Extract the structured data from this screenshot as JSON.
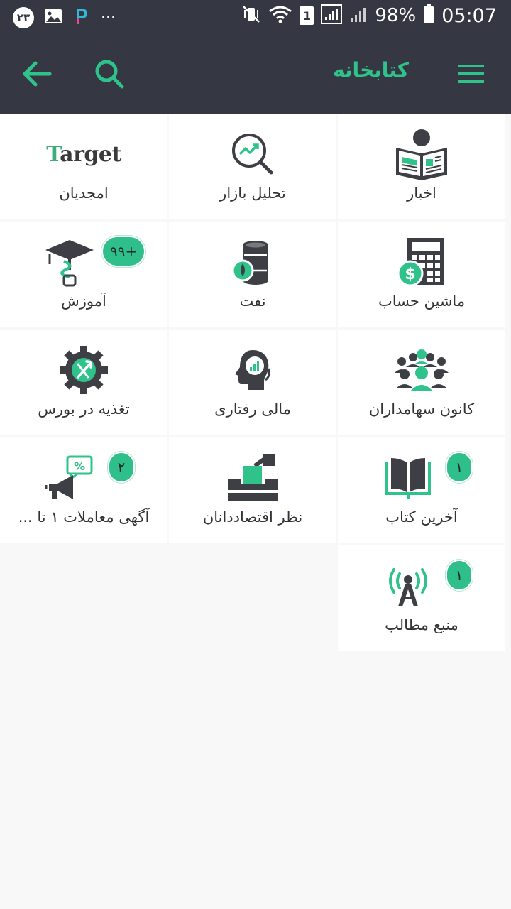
{
  "status_bar": {
    "left_badge": "۲۳",
    "more": "···",
    "sim": "1",
    "battery": "98%",
    "time": "05:07"
  },
  "appbar": {
    "title": "کتابخانه"
  },
  "colors": {
    "bar_bg": "#353842",
    "accent": "#2fc38b",
    "icon_dark": "#3e3f44",
    "badge": "#2fbf8a"
  },
  "tiles": [
    {
      "label": "اخبار",
      "icon": "newspaper-reader-icon",
      "badge": ""
    },
    {
      "label": "تحلیل بازار",
      "icon": "market-analysis-icon",
      "badge": ""
    },
    {
      "label": "امجدیان",
      "icon": "target-logo",
      "logo_text": "Target",
      "badge": ""
    },
    {
      "label": "ماشین حساب",
      "icon": "calculator-dollar-icon",
      "badge": ""
    },
    {
      "label": "نفت",
      "icon": "oil-barrel-icon",
      "badge": ""
    },
    {
      "label": "آموزش",
      "icon": "education-cap-icon",
      "badge": "۹۹+"
    },
    {
      "label": "کانون سهامداران",
      "icon": "shareholders-group-icon",
      "badge": ""
    },
    {
      "label": "مالی رفتاری",
      "icon": "behavioral-finance-icon",
      "badge": ""
    },
    {
      "label": "تغذیه در بورس",
      "icon": "gear-food-icon",
      "badge": ""
    },
    {
      "label": "آخرین کتاب",
      "icon": "open-book-icon",
      "badge": "۱"
    },
    {
      "label": "نظر اقتصاددانان",
      "icon": "ballot-box-icon",
      "badge": ""
    },
    {
      "label": "آگهی معاملات ۱ تا ...",
      "icon": "megaphone-percent-icon",
      "badge": "۲"
    },
    {
      "label": "منبع مطالب",
      "icon": "radio-tower-icon",
      "badge": "۱"
    }
  ]
}
